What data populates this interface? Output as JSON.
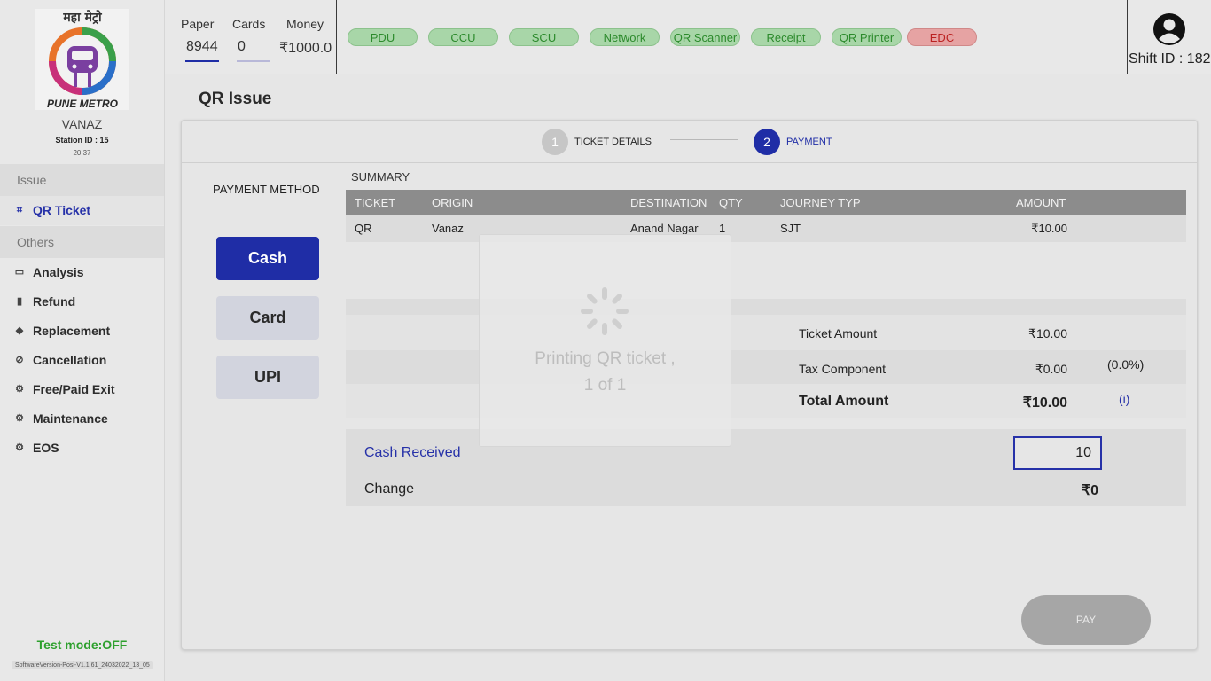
{
  "sidebar": {
    "logo_hindi": "महा मेट्रो",
    "logo_en": "PUNE METRO",
    "station_name": "VANAZ",
    "station_id": "Station ID : 15",
    "time": "20:37",
    "sections": [
      {
        "label": "Issue"
      },
      {
        "label": "Others"
      }
    ],
    "items": [
      {
        "label": "QR Ticket",
        "icon": "qr-icon"
      },
      {
        "label": "Analysis",
        "icon": "analysis-icon"
      },
      {
        "label": "Refund",
        "icon": "refund-icon"
      },
      {
        "label": "Replacement",
        "icon": "replacement-icon"
      },
      {
        "label": "Cancellation",
        "icon": "cancellation-icon"
      },
      {
        "label": "Free/Paid Exit",
        "icon": "gear-icon"
      },
      {
        "label": "Maintenance",
        "icon": "gear-icon"
      },
      {
        "label": "EOS",
        "icon": "gear-icon"
      }
    ],
    "test_mode": "Test mode:OFF",
    "version": "SoftwareVersion-Posi-V1.1.61_24032022_13_05"
  },
  "topbar": {
    "paper_label": "Paper",
    "paper_value": "8944",
    "cards_label": "Cards",
    "cards_value": "0",
    "money_label": "Money",
    "money_value": "₹1000.0",
    "devices": [
      {
        "label": "PDU",
        "status": "ok"
      },
      {
        "label": "CCU",
        "status": "ok"
      },
      {
        "label": "SCU",
        "status": "ok"
      },
      {
        "label": "Network",
        "status": "ok"
      },
      {
        "label": "QR Scanner",
        "status": "ok"
      },
      {
        "label": "Receipt",
        "status": "ok"
      },
      {
        "label": "QR Printer",
        "status": "ok"
      },
      {
        "label": "EDC",
        "status": "error"
      }
    ],
    "shift_id": "Shift ID : 182"
  },
  "page": {
    "title": "QR Issue",
    "steps": [
      {
        "number": "1",
        "label": "TICKET DETAILS"
      },
      {
        "number": "2",
        "label": "PAYMENT"
      }
    ],
    "payment_method_title": "PAYMENT METHOD",
    "payment_methods": [
      "Cash",
      "Card",
      "UPI"
    ],
    "selected_method": "Cash",
    "summary_title": "SUMMARY",
    "table": {
      "headers": [
        "TICKET",
        "ORIGIN",
        "DESTINATION",
        "QTY",
        "JOURNEY TYP",
        "AMOUNT"
      ],
      "rows": [
        [
          "QR",
          "Vanaz",
          "Anand Nagar",
          "1",
          "SJT",
          "₹10.00"
        ]
      ]
    },
    "totals": {
      "ticket_amount_label": "Ticket Amount",
      "ticket_amount": "₹10.00",
      "tax_label": "Tax  Component",
      "tax": "₹0.00",
      "tax_pct": "(0.0%)",
      "total_label": "Total Amount",
      "total": "₹10.00",
      "info": "(i)"
    },
    "cash_received_label": "Cash Received",
    "cash_received_value": "10",
    "change_label": "Change",
    "change_value": "₹0",
    "pay_label": "PAY"
  },
  "overlay": {
    "message_line1": "Printing QR ticket ,",
    "message_line2": "1 of 1"
  },
  "colors": {
    "accent": "#1f2da6",
    "ok_pill": "#a8d6a8",
    "error_pill": "#e6a3a3",
    "test_mode": "#2da02d"
  }
}
